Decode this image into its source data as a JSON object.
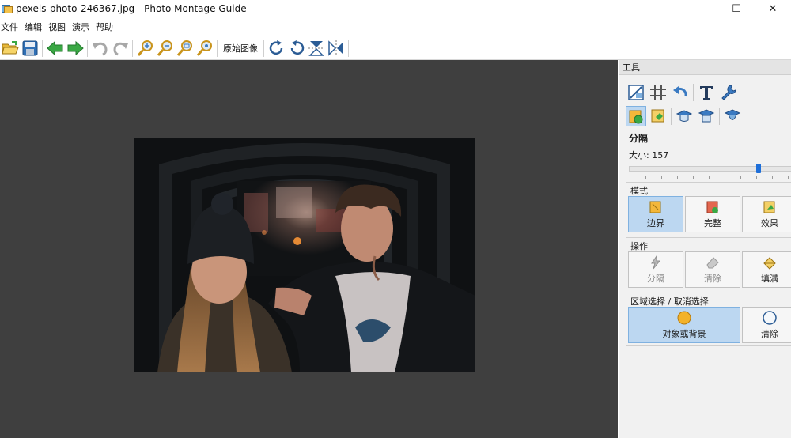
{
  "window": {
    "title": "pexels-photo-246367.jpg - Photo Montage Guide",
    "minimize_glyph": "—",
    "maximize_glyph": "☐",
    "close_glyph": "✕"
  },
  "menu": [
    "文件",
    "编辑",
    "视图",
    "演示",
    "帮助"
  ],
  "toolbar": {
    "original_image_label": "原始图像",
    "icons": [
      "open-icon",
      "save-icon",
      "back-arrow-icon",
      "forward-arrow-icon",
      "undo-icon",
      "redo-icon",
      "zoom-in-icon",
      "zoom-out-icon",
      "zoom-fit-icon",
      "zoom-actual-icon",
      "rotate-right-icon",
      "rotate-left-icon",
      "flip-vertical-icon",
      "flip-horizontal-icon"
    ]
  },
  "panel": {
    "header": "工具",
    "section_title": "分隔",
    "size_label": "大小: 157",
    "size_value": 157,
    "mode": {
      "label": "模式",
      "buttons": [
        "边界",
        "完整",
        "效果"
      ]
    },
    "operation": {
      "label": "操作",
      "buttons": [
        "分隔",
        "清除",
        "填满"
      ]
    },
    "selection": {
      "label": "区域选择 / 取消选择",
      "buttons": [
        "对象或背景",
        "清除"
      ]
    }
  },
  "colors": {
    "canvas": "#3f3f3f",
    "accent_active": "#bcd7f1",
    "slider_thumb": "#1e6fd9",
    "arrow_green": "#3aa844"
  }
}
